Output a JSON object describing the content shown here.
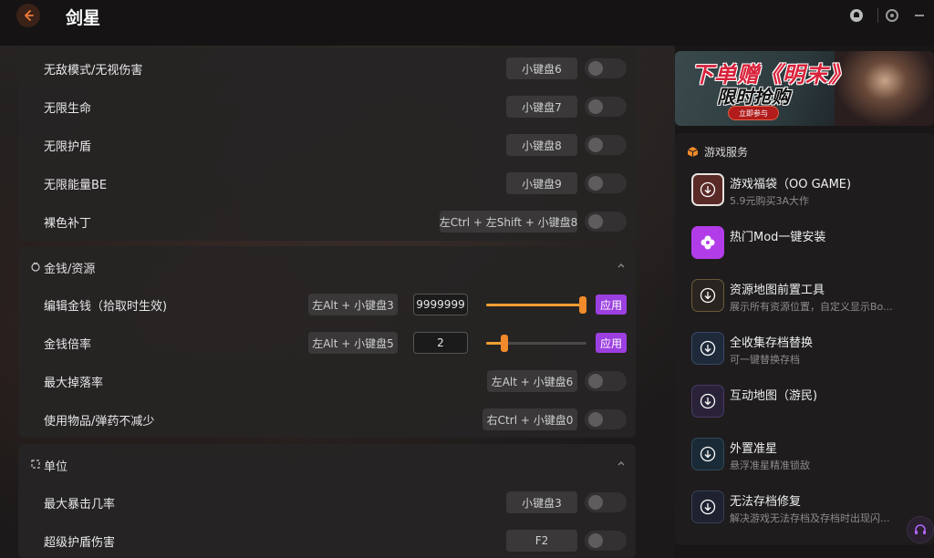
{
  "header": {
    "title": "剑星",
    "back_icon": "arrow-left-icon",
    "icons": [
      "notification-icon",
      "settings-icon",
      "minimize-icon"
    ]
  },
  "cheats_top": [
    {
      "label": "无敌模式/无视伤害",
      "hotkey": "小键盘6"
    },
    {
      "label": "无限生命",
      "hotkey": "小键盘7"
    },
    {
      "label": "无限护盾",
      "hotkey": "小键盘8"
    },
    {
      "label": "无限能量BE",
      "hotkey": "小键盘9"
    },
    {
      "label": "裸色补丁",
      "hotkey": "左Ctrl + 左Shift + 小键盘8"
    }
  ],
  "money_section": {
    "title": "金钱/资源",
    "rows": [
      {
        "label": "编辑金钱（拾取时生效)",
        "hotkey": "左Alt + 小键盘3",
        "value": "9999999",
        "slider_level": 1.0,
        "apply": "应用"
      },
      {
        "label": "金钱倍率",
        "hotkey": "左Alt + 小键盘5",
        "value": "2",
        "slider_level": 0.18,
        "apply": "应用"
      },
      {
        "label": "最大掉落率",
        "hotkey": "左Alt + 小键盘6"
      },
      {
        "label": "使用物品/弹药不减少",
        "hotkey": "右Ctrl + 小键盘0"
      }
    ]
  },
  "unit_section": {
    "title": "单位",
    "rows": [
      {
        "label": "最大暴击几率",
        "hotkey": "小键盘3"
      },
      {
        "label": "超级护盾伤害",
        "hotkey": "F2"
      }
    ]
  },
  "banner": {
    "line1": "下单赠《明末》",
    "line2": "限时抢购",
    "button": "立即参与"
  },
  "services": {
    "title": "游戏服务",
    "items": [
      {
        "name": "游戏福袋（OO GAME)",
        "desc": "5.9元购买3A大作"
      },
      {
        "name": "热门Mod一键安装",
        "desc": ""
      },
      {
        "name": "资源地图前置工具",
        "desc": "展示所有资源位置，自定义显示Bo..."
      },
      {
        "name": "全收集存档替换",
        "desc": "可一键替换存档"
      },
      {
        "name": "互动地图（游民)",
        "desc": ""
      },
      {
        "name": "外置准星",
        "desc": "悬浮准星精准锁敌"
      },
      {
        "name": "无法存档修复",
        "desc": "解决游戏无法存档及存档时出现闪..."
      }
    ]
  },
  "colors": {
    "accent_orange": "#f0a030",
    "apply_purple": "#9b3fe0",
    "card_bg": "#262424"
  }
}
